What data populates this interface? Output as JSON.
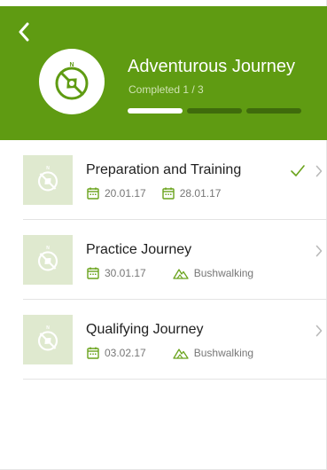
{
  "header": {
    "title": "Adventurous Journey",
    "subtitle": "Completed 1 / 3",
    "compass_letter": "N",
    "progress": {
      "completed": 1,
      "total": 3
    },
    "bg_color": "#5f9b12"
  },
  "icons": {
    "back": "chevron-left-icon",
    "compass": "compass-icon",
    "calendar": "calendar-icon",
    "terrain": "mountain-icon",
    "check": "checkmark-icon",
    "chevron": "chevron-right-icon"
  },
  "items": [
    {
      "title": "Preparation and Training",
      "date_start": "20.01.17",
      "date_end": "28.01.17",
      "completed": true
    },
    {
      "title": "Practice Journey",
      "date": "30.01.17",
      "activity": "Bushwalking",
      "completed": false
    },
    {
      "title": "Qualifying Journey",
      "date": "03.02.17",
      "activity": "Bushwalking",
      "completed": false
    }
  ]
}
